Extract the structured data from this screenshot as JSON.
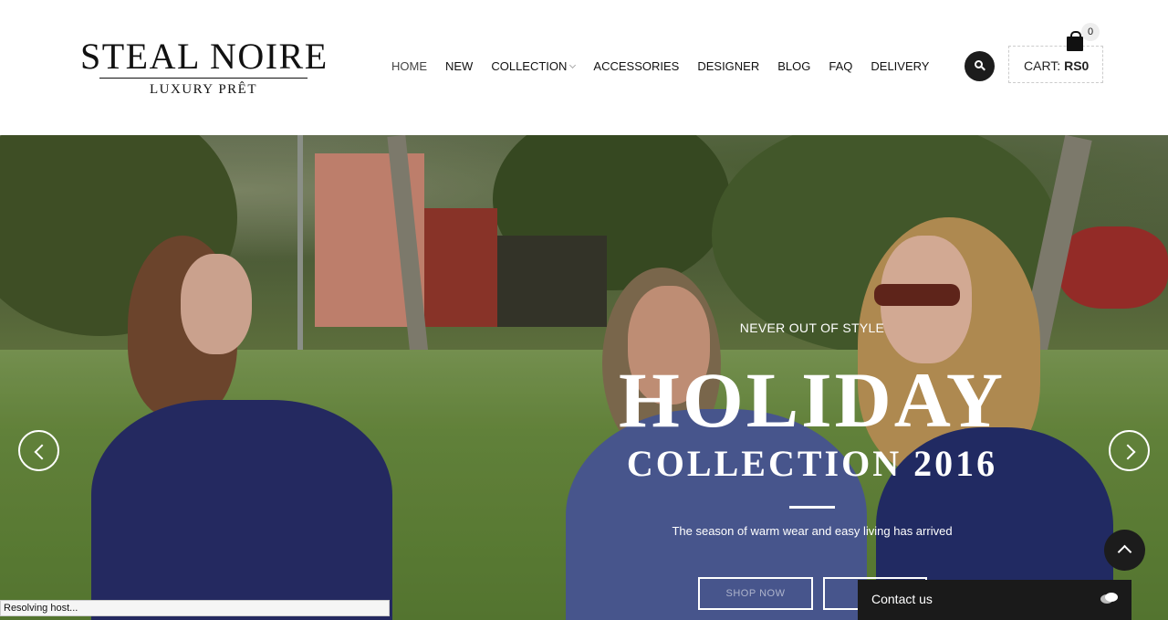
{
  "brand": {
    "name": "STEAL NOIRE",
    "tagline": "LUXURY PRÊT"
  },
  "nav": {
    "items": [
      {
        "label": "HOME",
        "active": true
      },
      {
        "label": "NEW"
      },
      {
        "label": "COLLECTION",
        "has_dropdown": true
      },
      {
        "label": "ACCESSORIES"
      },
      {
        "label": "DESIGNER"
      },
      {
        "label": "BLOG"
      },
      {
        "label": "FAQ"
      },
      {
        "label": "DELIVERY"
      }
    ]
  },
  "header": {
    "search_icon": "search-icon",
    "cart": {
      "label": "CART:",
      "amount": "RS0",
      "count": "0",
      "icon": "shopping-bag-icon"
    }
  },
  "hero": {
    "subtitle": "NEVER OUT OF STYLE",
    "title": "HOLIDAY",
    "title2": "COLLECTION 2016",
    "description": "The season of warm wear and easy living has arrived",
    "primary_button": "SHOP NOW",
    "secondary_button": "",
    "prev_icon": "chevron-left-icon",
    "next_icon": "chevron-right-icon"
  },
  "widgets": {
    "back_to_top_icon": "chevron-up-icon",
    "contact_label": "Contact us",
    "chat_icon": "chat-bubbles-icon"
  },
  "browser": {
    "status": "Resolving host..."
  },
  "colors": {
    "accent_dark": "#1c1c1c",
    "text": "#111111",
    "hero_text": "#ffffff"
  }
}
